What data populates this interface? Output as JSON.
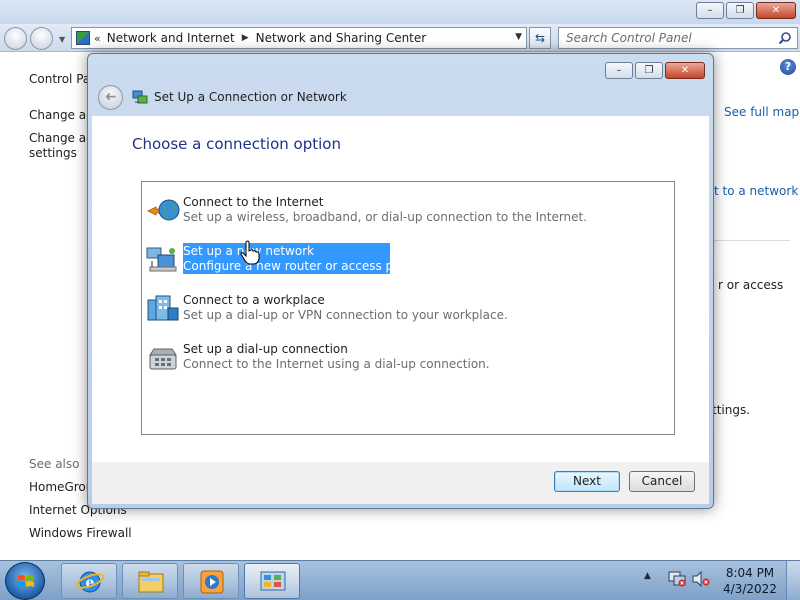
{
  "window": {
    "breadcrumbs": [
      "Network and Internet",
      "Network and Sharing Center"
    ],
    "overflow_chevron": "«",
    "search_placeholder": "Search Control Panel",
    "help_symbol": "?",
    "min_symbol": "–",
    "max_symbol": "❐",
    "close_symbol": "✕"
  },
  "left_pane": {
    "control_panel": "Control Pa",
    "change_adapter": "Change ad",
    "change_advanced_1": "Change ad",
    "change_advanced_2": "settings",
    "see_also": "See also",
    "homegroup": "HomeGrou",
    "internet_options": "Internet Options",
    "windows_firewall": "Windows Firewall"
  },
  "right_pane": {
    "see_full_map": "See full map",
    "connect_network": "t to a network",
    "or_access": "r or access",
    "settings": "ttings."
  },
  "dialog": {
    "title": "Set Up a Connection or Network",
    "back_symbol": "➜",
    "heading": "Choose a connection option",
    "options": [
      {
        "title": "Connect to the Internet",
        "desc": "Set up a wireless, broadband, or dial-up connection to the Internet.",
        "icon": "globe-icon"
      },
      {
        "title": "Set up a new network",
        "desc": "Configure a new router or access point.",
        "icon": "network-computers-icon"
      },
      {
        "title": "Connect to a workplace",
        "desc": "Set up a dial-up or VPN connection to your workplace.",
        "icon": "workplace-building-icon"
      },
      {
        "title": "Set up a dial-up connection",
        "desc": "Connect to the Internet using a dial-up connection.",
        "icon": "telephone-icon"
      }
    ],
    "selected_index": 1,
    "next_label": "Next",
    "cancel_label": "Cancel"
  },
  "taskbar": {
    "time": "8:04 PM",
    "date": "4/3/2022",
    "tray_arrow": "▲",
    "pinned": [
      "internet-explorer-icon",
      "windows-explorer-icon",
      "media-player-icon",
      "control-panel-icon"
    ]
  },
  "colors": {
    "selection": "#3399ff",
    "heading": "#1e3287",
    "link": "#1a5dab"
  }
}
